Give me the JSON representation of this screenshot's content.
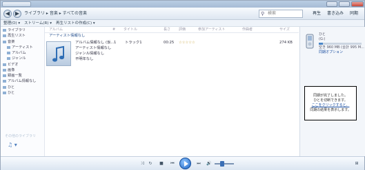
{
  "breadcrumb": "ライブラリ ▸ 音楽 ▸ すべての音楽",
  "search_placeholder": "検索",
  "tabs": [
    "再生",
    "書き込み",
    "同期"
  ],
  "toolbar": [
    "整理(O) ▾",
    "ストリーム(R) ▾",
    "再生リストの作成(C) ▾"
  ],
  "columns": [
    "アルバム",
    "#",
    "タイトル",
    "長さ",
    "評価",
    "参加アーティスト",
    "作曲者",
    "サイズ"
  ],
  "sidebar": [
    "ライブラリ",
    "再生リスト",
    "音楽",
    "アーティスト",
    "アルバム",
    "ジャンル",
    "ビデオ",
    "画像",
    "録画一覧",
    "アルバム情報なし",
    "ひと",
    "ひと"
  ],
  "album": {
    "group_label": "アーティスト情報なし",
    "title": "アルバム情報なし (仮...",
    "artist": "アーティスト情報なし",
    "genre": "ジャンル情報なし",
    "year": "不明年なし",
    "track_no": "1",
    "track_title": "トラック1",
    "length": "00:25",
    "size": "274 KB"
  },
  "device": {
    "name": "ひと",
    "drive": "(G:)",
    "capacity": "空き 960 MB (合計 995 M...",
    "options": "同期オプション"
  },
  "sync_message": [
    "同期が完了しました。",
    "ひとを切断できます。",
    "ここをクリックすると、",
    "同期の結果を表示します。"
  ],
  "other_libraries": "その他のライブラリ",
  "player": {
    "shuffle": "⤨",
    "repeat": "↻",
    "stop": "■",
    "prev": "⏮",
    "next": "⏭",
    "mute": "🔊",
    "switch": "⊞"
  }
}
